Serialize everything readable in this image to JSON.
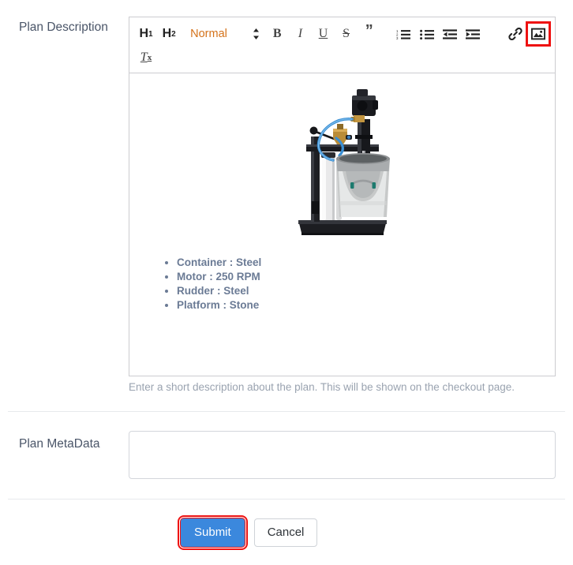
{
  "form": {
    "description_label": "Plan Description",
    "metadata_label": "Plan MetaData",
    "help_text": "Enter a short description about the plan. This will be shown on the checkout page.",
    "metadata_value": "",
    "metadata_placeholder": ""
  },
  "toolbar": {
    "h1_label": "H",
    "h1_sub": "1",
    "h2_label": "H",
    "h2_sub": "2",
    "block_format": "Normal",
    "bold_label": "B",
    "italic_label": "I",
    "underline_label": "U",
    "strike_label": "S",
    "quote_label": "”",
    "clear_label": "T",
    "clear_sub": "x",
    "items": [
      {
        "name": "header-1",
        "label": "H1"
      },
      {
        "name": "header-2",
        "label": "H2"
      },
      {
        "name": "block-format-picker",
        "label": "Normal"
      },
      {
        "name": "bold",
        "label": "B"
      },
      {
        "name": "italic",
        "label": "I"
      },
      {
        "name": "underline",
        "label": "U"
      },
      {
        "name": "strikethrough",
        "label": "S"
      },
      {
        "name": "blockquote",
        "label": "”"
      },
      {
        "name": "ordered-list",
        "label": "Ordered List"
      },
      {
        "name": "bullet-list",
        "label": "Bullet List"
      },
      {
        "name": "outdent",
        "label": "Outdent"
      },
      {
        "name": "indent",
        "label": "Indent"
      },
      {
        "name": "link",
        "label": "Link"
      },
      {
        "name": "image",
        "label": "Image"
      },
      {
        "name": "clear-formatting",
        "label": "Tx"
      }
    ]
  },
  "content": {
    "image_alt": "Pneumatic paint mixer with stainless steel drum on black stand",
    "specs": [
      "Container : Steel",
      "Motor : 250 RPM",
      "Rudder : Steel",
      "Platform : Stone"
    ]
  },
  "actions": {
    "submit_label": "Submit",
    "cancel_label": "Cancel"
  },
  "colors": {
    "primary_button": "#3b88dd",
    "highlight": "#ee1111",
    "label_text": "#4a5568",
    "spec_text": "#6b7b95",
    "help_text": "#9aa3b0",
    "picker_text": "#d4721a",
    "border": "#ccccd0"
  }
}
